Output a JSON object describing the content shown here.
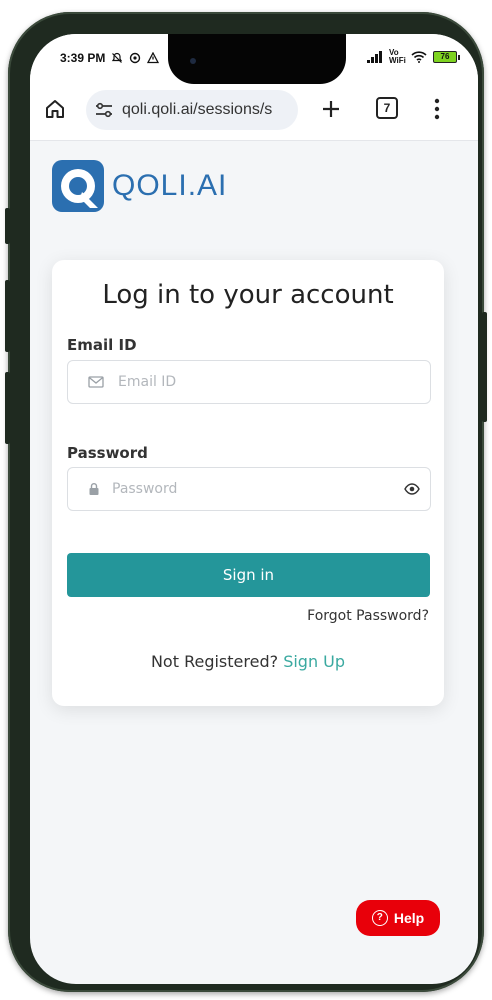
{
  "status_bar": {
    "time": "3:39 PM",
    "network_label": "Vo WiFi",
    "battery": "76"
  },
  "browser": {
    "url": "qoli.qoli.ai/sessions/s",
    "tab_count": "7"
  },
  "brand": {
    "name": "QOLI.AI",
    "color": "#2b6fb0"
  },
  "login": {
    "title": "Log in to your account",
    "email_label": "Email ID",
    "email_placeholder": "Email ID",
    "password_label": "Password",
    "password_placeholder": "Password",
    "signin_label": "Sign in",
    "forgot_label": "Forgot Password?",
    "register_text": "Not Registered?",
    "signup_label": "Sign Up",
    "accent_color": "#24969a"
  },
  "help": {
    "label": "Help",
    "color": "#e8000a"
  },
  "icons": {
    "home": "home-icon",
    "tune": "tune-icon",
    "plus": "plus-icon",
    "tabs": "tabs-icon",
    "menu": "more-vert-icon",
    "email": "mail-icon",
    "lock": "lock-icon",
    "eye": "eye-icon",
    "help": "help-icon"
  }
}
